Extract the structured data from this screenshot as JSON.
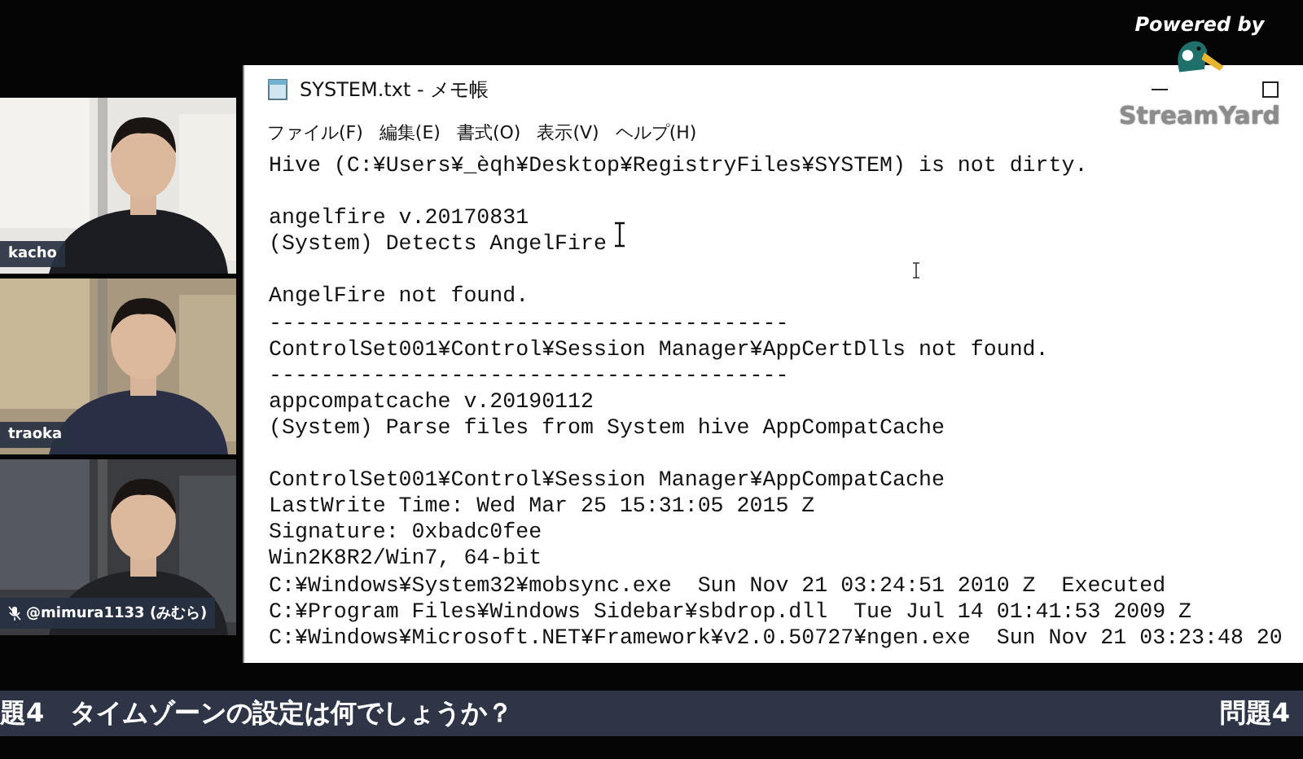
{
  "overlay": {
    "powered_by": "Powered by",
    "brand": "StreamYard"
  },
  "participants": [
    {
      "name": "kacho",
      "muted": false
    },
    {
      "name": "traoka",
      "muted": false
    },
    {
      "name": "@mimura1133 (みむら)",
      "muted": true
    }
  ],
  "notepad": {
    "title": "SYSTEM.txt - メモ帳",
    "menu": [
      "ファイル(F)",
      "編集(E)",
      "書式(O)",
      "表示(V)",
      "ヘルプ(H)"
    ],
    "lines": [
      {
        "kind": "text",
        "text": "Hive (C:¥Users¥_èqh¥Desktop¥RegistryFiles¥SYSTEM) is not dirty."
      },
      {
        "kind": "blank"
      },
      {
        "kind": "text",
        "text": "angelfire v.20170831"
      },
      {
        "kind": "text",
        "text": "(System) Detects AngelFire"
      },
      {
        "kind": "blank"
      },
      {
        "kind": "text",
        "text": "AngelFire not found."
      },
      {
        "kind": "text",
        "text": "----------------------------------------"
      },
      {
        "kind": "text",
        "text": "ControlSet001¥Control¥Session Manager¥AppCertDlls not found."
      },
      {
        "kind": "text",
        "text": "----------------------------------------"
      },
      {
        "kind": "text",
        "text": "appcompatcache v.20190112"
      },
      {
        "kind": "text",
        "text": "(System) Parse files from System hive AppCompatCache"
      },
      {
        "kind": "blank"
      },
      {
        "kind": "text",
        "text": "ControlSet001¥Control¥Session Manager¥AppCompatCache"
      },
      {
        "kind": "text",
        "text": "LastWrite Time: Wed Mar 25 15:31:05 2015 Z"
      },
      {
        "kind": "text",
        "text": "Signature: 0xbadc0fee"
      },
      {
        "kind": "text",
        "text": "Win2K8R2/Win7, 64-bit"
      },
      {
        "kind": "text",
        "text": "C:¥Windows¥System32¥mobsync.exe  Sun Nov 21 03:24:51 2010 Z  Executed"
      },
      {
        "kind": "text",
        "text": "C:¥Program Files¥Windows Sidebar¥sbdrop.dll  Tue Jul 14 01:41:53 2009 Z"
      },
      {
        "kind": "text",
        "text": "C:¥Windows¥Microsoft.NET¥Framework¥v2.0.50727¥ngen.exe  Sun Nov 21 03:23:48 20"
      }
    ]
  },
  "ticker": {
    "text": "題4　タイムゾーンの設定は何でしょうか？",
    "badge": "問題4"
  }
}
